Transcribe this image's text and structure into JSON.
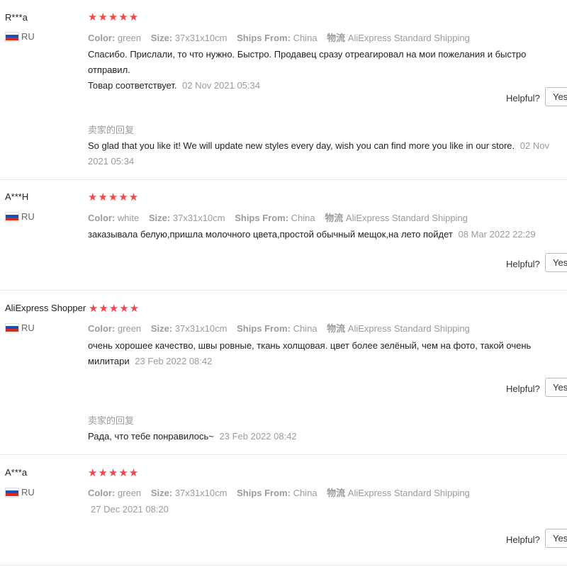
{
  "labels": {
    "color": "Color:",
    "size": "Size:",
    "ships_from": "Ships From:",
    "shipping_label": "物流",
    "helpful": "Helpful?",
    "yes": "Yes",
    "seller_reply": "卖家的回复"
  },
  "reviews": [
    {
      "user": "R***a",
      "country": "RU",
      "rating": 5,
      "stars": "★★★★★",
      "color": "green",
      "size": "37x31x10cm",
      "ships_from": "China",
      "shipping": "AliExpress Standard Shipping",
      "text_line1": "Спасибо. Прислали, то что нужно. Быстро. Продавец сразу отреагировал на мои пожелания и быстро отправил.",
      "text_line2": "Товар соответствует.",
      "date": "02 Nov 2021 05:34",
      "reply_text": "So glad that you like it! We will update new styles every day, wish you can find more you like in our store.",
      "reply_date_part1": "02 Nov",
      "reply_date_part2": "2021 05:34"
    },
    {
      "user": "A***H",
      "country": "RU",
      "rating": 5,
      "stars": "★★★★★",
      "color": "white",
      "size": "37x31x10cm",
      "ships_from": "China",
      "shipping": "AliExpress Standard Shipping",
      "text_line1": "заказывала белую,пришла молочного цвета,простой обычный мещок,на лето пойдет",
      "date": "08 Mar 2022 22:29"
    },
    {
      "user": "AliExpress Shopper",
      "country": "RU",
      "rating": 5,
      "stars": "★★★★★",
      "color": "green",
      "size": "37x31x10cm",
      "ships_from": "China",
      "shipping": "AliExpress Standard Shipping",
      "text_line1": "очень хорошее качество, швы ровные, ткань холщовая. цвет более зелёный, чем на фото, такой очень",
      "text_line2": "милитари",
      "date": "23 Feb 2022 08:42",
      "reply_text": "Рада, что тебе понравилось~",
      "reply_date": "23 Feb 2022 08:42"
    },
    {
      "user": "A***a",
      "country": "RU",
      "rating": 5,
      "stars": "★★★★★",
      "color": "green",
      "size": "37x31x10cm",
      "ships_from": "China",
      "shipping": "AliExpress Standard Shipping",
      "date": "27 Dec 2021 08:20"
    }
  ]
}
